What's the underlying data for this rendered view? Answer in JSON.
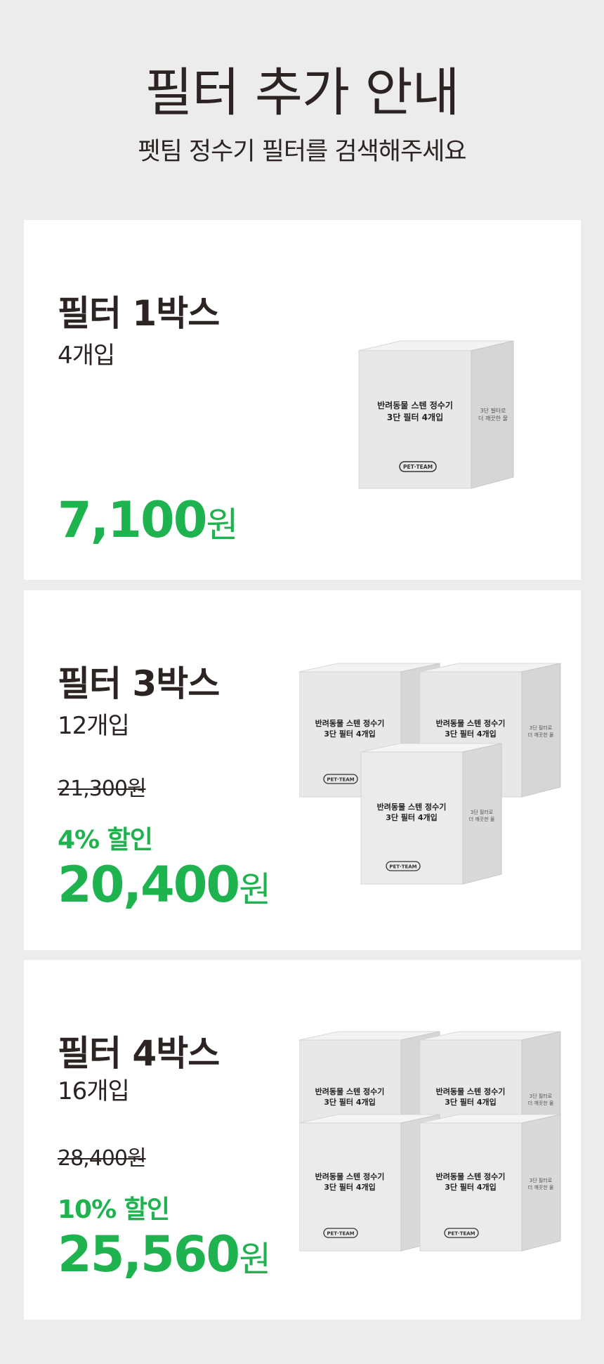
{
  "header": {
    "title": "필터 추가 안내",
    "subtitle": "펫팀 정수기 필터를 검색해주세요"
  },
  "products": [
    {
      "name": "필터 1박스",
      "count": "4개입",
      "price_number": "7,100",
      "price_unit": "원"
    },
    {
      "name": "필터 3박스",
      "count": "12개입",
      "original_price": "21,300원",
      "discount": "4% 할인",
      "price_number": "20,400",
      "price_unit": "원"
    },
    {
      "name": "필터 4박스",
      "count": "16개입",
      "original_price": "28,400원",
      "discount": "10% 할인",
      "price_number": "25,560",
      "price_unit": "원"
    }
  ],
  "box_label": {
    "line1": "반려동물 스텐 정수기",
    "line2": "3단 필터 4개입",
    "side1": "3단 필터로",
    "side2": "더 깨끗한 물",
    "brand": "PET·TEAM"
  },
  "colors": {
    "background": "#ececec",
    "card": "#ffffff",
    "accent_green": "#1fb350",
    "text": "#2b2422"
  }
}
